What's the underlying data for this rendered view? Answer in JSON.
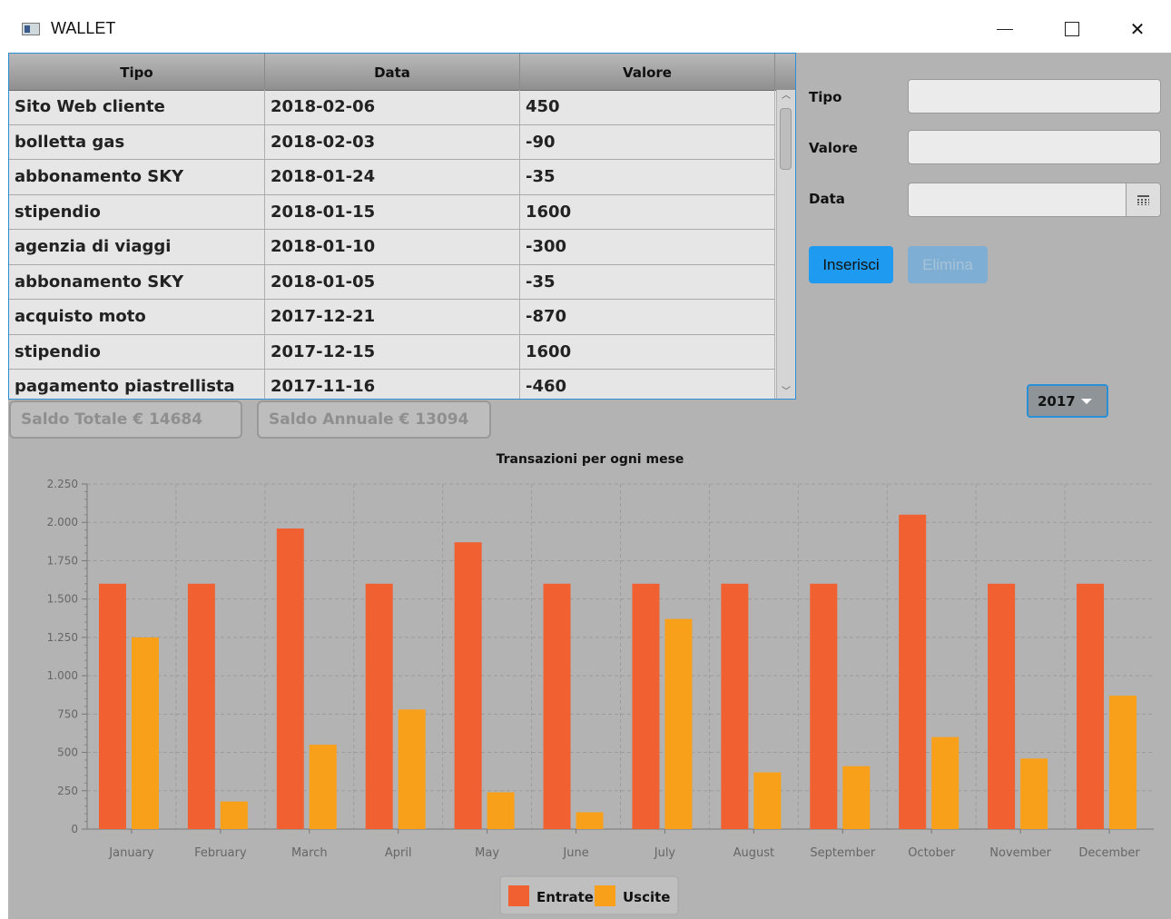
{
  "window": {
    "title": "WALLET",
    "icon": "app-window-icon",
    "controls": [
      "minimize-icon",
      "maximize-icon",
      "close-icon"
    ]
  },
  "table": {
    "columns": [
      "Tipo",
      "Data",
      "Valore"
    ],
    "rows": [
      [
        "Sito Web cliente",
        "2018-02-06",
        "450"
      ],
      [
        "bolletta gas",
        "2018-02-03",
        "-90"
      ],
      [
        "abbonamento SKY",
        "2018-01-24",
        "-35"
      ],
      [
        "stipendio",
        "2018-01-15",
        "1600"
      ],
      [
        "agenzia di viaggi",
        "2018-01-10",
        "-300"
      ],
      [
        "abbonamento SKY",
        "2018-01-05",
        "-35"
      ],
      [
        "acquisto moto",
        "2017-12-21",
        "-870"
      ],
      [
        "stipendio",
        "2017-12-15",
        "1600"
      ],
      [
        "pagamento piastrellista",
        "2017-11-16",
        "-460"
      ]
    ]
  },
  "form": {
    "tipo_label": "Tipo",
    "valore_label": "Valore",
    "data_label": "Data",
    "tipo_value": "",
    "valore_value": "",
    "data_value": "",
    "insert_label": "Inserisci",
    "delete_label": "Elimina"
  },
  "year_select": {
    "value": "2017"
  },
  "saldo": {
    "totale": "Saldo Totale € 14684",
    "annuale": "Saldo Annuale € 13094"
  },
  "colors": {
    "entrate": "#f06030",
    "uscite": "#f8a01a",
    "accent": "#1e9bf0"
  },
  "chart_data": {
    "type": "bar",
    "title": "Transazioni per ogni mese",
    "xlabel": "",
    "ylabel": "",
    "ylim": [
      0,
      2250
    ],
    "yticks": [
      "0",
      "250",
      "500",
      "750",
      "1.000",
      "1.250",
      "1.500",
      "1.750",
      "2.000",
      "2.250"
    ],
    "yvalues": [
      0,
      250,
      500,
      750,
      1000,
      1250,
      1500,
      1750,
      2000,
      2250
    ],
    "grid": true,
    "legend": "bottom-center",
    "categories": [
      "January",
      "February",
      "March",
      "April",
      "May",
      "June",
      "July",
      "August",
      "September",
      "October",
      "November",
      "December"
    ],
    "series": [
      {
        "name": "Entrate",
        "values": [
          1600,
          1600,
          1960,
          1600,
          1870,
          1600,
          1600,
          1600,
          1600,
          2050,
          1600,
          1600
        ]
      },
      {
        "name": "Uscite",
        "values": [
          1250,
          180,
          550,
          780,
          240,
          110,
          1370,
          370,
          410,
          600,
          460,
          870
        ]
      }
    ]
  }
}
